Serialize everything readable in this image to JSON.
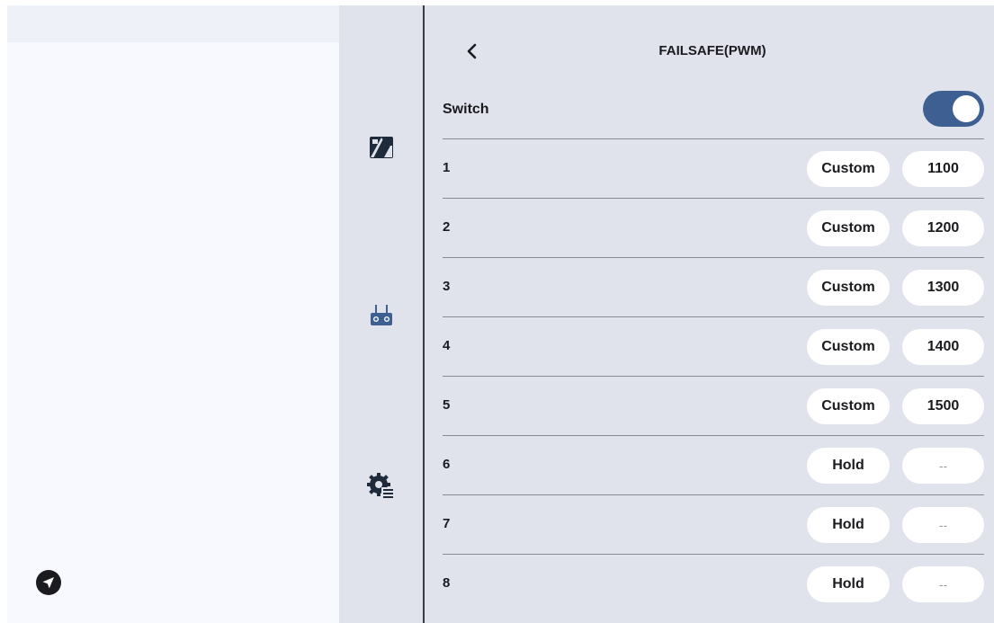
{
  "header": {
    "title": "FAILSAFE(PWM)",
    "back_icon": "chevron-left-icon"
  },
  "nav_rail": {
    "items": [
      {
        "icon": "image-swap-icon"
      },
      {
        "icon": "remote-controller-icon"
      },
      {
        "icon": "settings-gear-list-icon"
      }
    ]
  },
  "left_panel": {
    "fab_icon": "navigation-arrow-icon"
  },
  "switch": {
    "label": "Switch",
    "on": true
  },
  "channels": [
    {
      "label": "1",
      "mode": "Custom",
      "value": "1100"
    },
    {
      "label": "2",
      "mode": "Custom",
      "value": "1200"
    },
    {
      "label": "3",
      "mode": "Custom",
      "value": "1300"
    },
    {
      "label": "4",
      "mode": "Custom",
      "value": "1400"
    },
    {
      "label": "5",
      "mode": "Custom",
      "value": "1500"
    },
    {
      "label": "6",
      "mode": "Hold",
      "value": "--"
    },
    {
      "label": "7",
      "mode": "Hold",
      "value": "--"
    },
    {
      "label": "8",
      "mode": "Hold",
      "value": "--"
    }
  ],
  "colors": {
    "accent": "#3e5f92",
    "content_bg": "#e0e2ec",
    "pill_bg": "#ffffff",
    "rail_icon_dark": "#1f2a3a"
  }
}
